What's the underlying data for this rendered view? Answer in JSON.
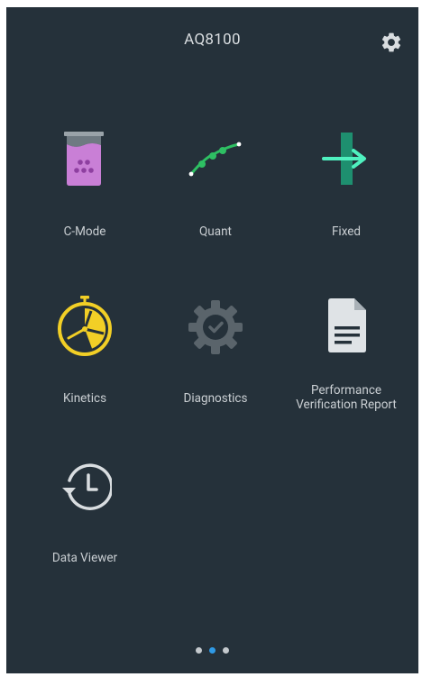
{
  "header": {
    "title": "AQ8100"
  },
  "tiles": [
    {
      "label": "C-Mode",
      "icon": "beaker-icon"
    },
    {
      "label": "Quant",
      "icon": "curve-icon"
    },
    {
      "label": "Fixed",
      "icon": "fixed-arrow-icon"
    },
    {
      "label": "Kinetics",
      "icon": "stopwatch-icon"
    },
    {
      "label": "Diagnostics",
      "icon": "gear-check-icon"
    },
    {
      "label": "Performance\nVerification Report",
      "label_line1": "Performance",
      "label_line2": "Verification Report",
      "icon": "document-icon"
    },
    {
      "label": "Data Viewer",
      "icon": "history-icon"
    }
  ],
  "pager": {
    "pages": 3,
    "active_index": 1
  },
  "colors": {
    "background": "#25313a",
    "text": "#c9ced2",
    "beaker": "#c97fd6",
    "curve": "#2ec063",
    "fixed_bar": "#1e8f6f",
    "fixed_arrow": "#4ff0bf",
    "stopwatch": "#f2cf26",
    "diag_gear": "#5a646b",
    "accent_dot": "#2f9ae6"
  }
}
